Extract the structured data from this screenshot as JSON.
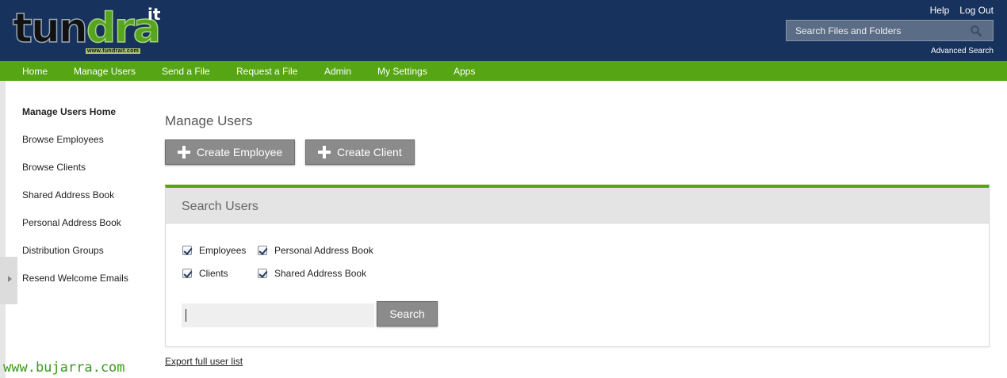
{
  "logo": {
    "part1": "tun",
    "part2": "dra",
    "sup": "it",
    "url": "www.tundrait.com"
  },
  "header": {
    "help": "Help",
    "logout": "Log Out",
    "search_placeholder": "Search Files and Folders",
    "advanced_search": "Advanced Search"
  },
  "nav": [
    "Home",
    "Manage Users",
    "Send a File",
    "Request a File",
    "Admin",
    "My Settings",
    "Apps"
  ],
  "sidebar": [
    "Manage Users Home",
    "Browse Employees",
    "Browse Clients",
    "Shared Address Book",
    "Personal Address Book",
    "Distribution Groups",
    "Resend Welcome Emails"
  ],
  "main": {
    "title": "Manage Users",
    "create_employee": "Create Employee",
    "create_client": "Create Client",
    "panel_title": "Search Users",
    "checkboxes": {
      "employees": "Employees",
      "personal_address_book": "Personal Address Book",
      "clients": "Clients",
      "shared_address_book": "Shared Address Book"
    },
    "search_value": "",
    "search_button": "Search",
    "export_link": "Export full user list"
  },
  "watermark": "www.bujarra.com",
  "colors": {
    "header_bg": "#17325c",
    "nav_bg": "#55a514",
    "button_bg": "#8b8b8b",
    "accent_green": "#55a514"
  }
}
